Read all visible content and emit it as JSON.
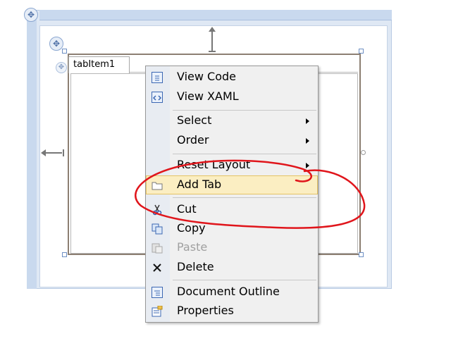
{
  "designer": {
    "tab_header": "tabItem1"
  },
  "context_menu": {
    "items": [
      {
        "label": "View Code",
        "icon": "view-code-icon",
        "enabled": true,
        "submenu": false
      },
      {
        "label": "View XAML",
        "icon": "view-xaml-icon",
        "enabled": true,
        "submenu": false
      },
      {
        "label": "Select",
        "icon": "",
        "enabled": true,
        "submenu": true
      },
      {
        "label": "Order",
        "icon": "",
        "enabled": true,
        "submenu": true
      },
      {
        "label": "Reset Layout",
        "icon": "",
        "enabled": true,
        "submenu": true
      },
      {
        "label": "Add Tab",
        "icon": "folder-icon",
        "enabled": true,
        "submenu": false,
        "highlighted": true
      },
      {
        "label": "Cut",
        "icon": "scissors-icon",
        "enabled": true,
        "submenu": false
      },
      {
        "label": "Copy",
        "icon": "copy-icon",
        "enabled": true,
        "submenu": false
      },
      {
        "label": "Paste",
        "icon": "paste-icon",
        "enabled": false,
        "submenu": false
      },
      {
        "label": "Delete",
        "icon": "delete-x-icon",
        "enabled": true,
        "submenu": false
      },
      {
        "label": "Document Outline",
        "icon": "document-outline-icon",
        "enabled": true,
        "submenu": false
      },
      {
        "label": "Properties",
        "icon": "properties-icon",
        "enabled": true,
        "submenu": false
      }
    ]
  },
  "annotation": {
    "color": "#e0151b"
  }
}
